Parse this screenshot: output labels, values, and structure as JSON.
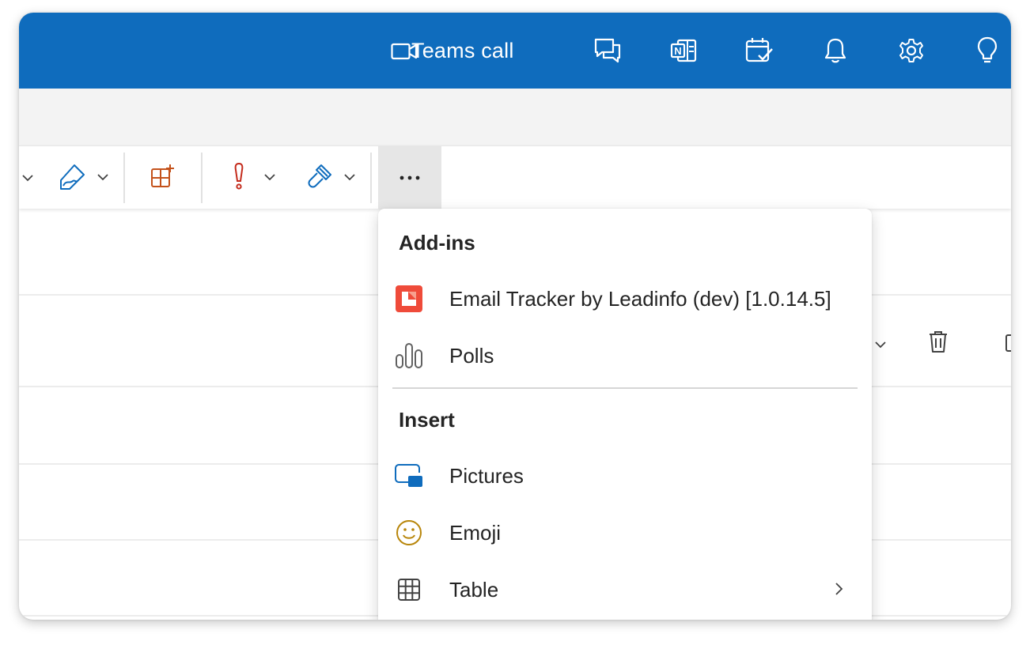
{
  "topbar": {
    "teams_call_label": "Teams call",
    "icons": [
      "video-camera-icon",
      "chat-icon",
      "onenote-icon",
      "calendar-check-icon",
      "bell-icon",
      "gear-icon",
      "lightbulb-icon"
    ]
  },
  "ribbon": {
    "items": [
      "chevron-down-icon",
      "signature-icon",
      "apps-add-icon",
      "importance-icon",
      "format-painter-icon"
    ],
    "more_label": "···"
  },
  "menu": {
    "addins_header": "Add-ins",
    "addins_items": [
      {
        "label": "Email Tracker by Leadinfo (dev) [1.0.14.5]",
        "icon": "leadinfo-logo-icon"
      },
      {
        "label": "Polls",
        "icon": "polls-bars-icon"
      }
    ],
    "insert_header": "Insert",
    "insert_items": [
      {
        "label": "Pictures",
        "icon": "picture-icon"
      },
      {
        "label": "Emoji",
        "icon": "emoji-smile-icon"
      },
      {
        "label": "Table",
        "icon": "table-grid-icon",
        "submenu": true
      }
    ]
  },
  "colors": {
    "accent_blue": "#0f6cbd",
    "orange": "#c4521b",
    "red": "#c42b1c",
    "leadinfo_red": "#ef4b3a",
    "emoji_gold": "#b8860b"
  }
}
